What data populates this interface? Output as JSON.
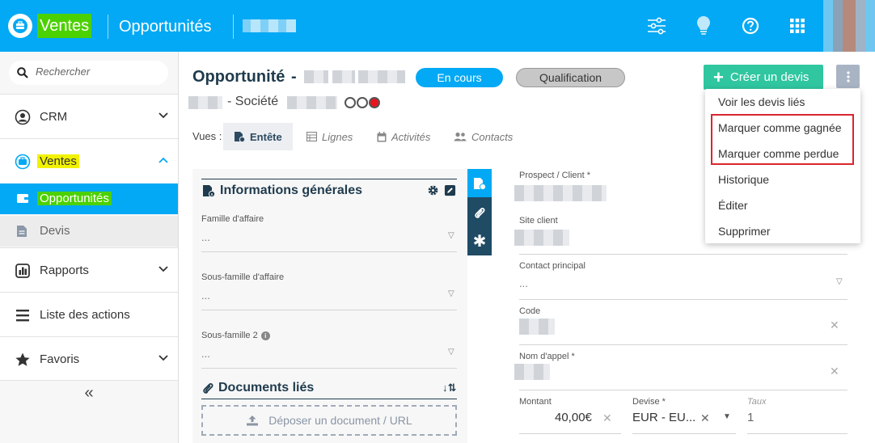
{
  "header": {
    "app_name": "Ventes",
    "page_name": "Opportunités"
  },
  "sidebar": {
    "search_placeholder": "Rechercher",
    "items": [
      {
        "label": "CRM"
      },
      {
        "label": "Ventes"
      },
      {
        "label": "Opportunités"
      },
      {
        "label": "Devis"
      },
      {
        "label": "Rapports"
      },
      {
        "label": "Liste des actions"
      },
      {
        "label": "Favoris"
      }
    ],
    "collapse_glyph": "«"
  },
  "main": {
    "title": "Opportunité",
    "title_sep": "-",
    "status_badge": "En cours",
    "stage_badge": "Qualification",
    "company_line": "- Société",
    "create_quote_label": "Créer un devis",
    "views_label": "Vues :",
    "tabs": [
      {
        "label": "Entête"
      },
      {
        "label": "Lignes"
      },
      {
        "label": "Activités"
      },
      {
        "label": "Contacts"
      }
    ],
    "general_info": {
      "title": "Informations générales",
      "fields": [
        {
          "label": "Famille d'affaire",
          "value": "..."
        },
        {
          "label": "Sous-famille d'affaire",
          "value": "..."
        },
        {
          "label": "Sous-famille 2",
          "value": "..."
        }
      ]
    },
    "documents": {
      "title": "Documents liés",
      "drop_label": "Déposer un document / URL"
    },
    "form": {
      "prospect_label": "Prospect / Client *",
      "site_label": "Site client",
      "contact_label": "Contact principal",
      "contact_value": "...",
      "code_label": "Code",
      "call_name_label": "Nom d'appel *",
      "amount_label": "Montant",
      "amount_value": "40,00€",
      "currency_label": "Devise *",
      "currency_value": "EUR - EU...",
      "rate_label": "Taux",
      "rate_value": "1"
    }
  },
  "menu": {
    "items": [
      {
        "label": "Voir les devis liés"
      },
      {
        "label": "Marquer comme gagnée"
      },
      {
        "label": "Marquer comme perdue"
      },
      {
        "label": "Historique"
      },
      {
        "label": "Éditer"
      },
      {
        "label": "Supprimer"
      }
    ]
  },
  "colors": {
    "primary": "#03a9f4",
    "highlight_green": "#4cd100",
    "highlight_yellow": "#f2f200",
    "create_button": "#2fc6a0",
    "menu_outline": "#d9262e",
    "dark_navy": "#1f3b4d"
  }
}
